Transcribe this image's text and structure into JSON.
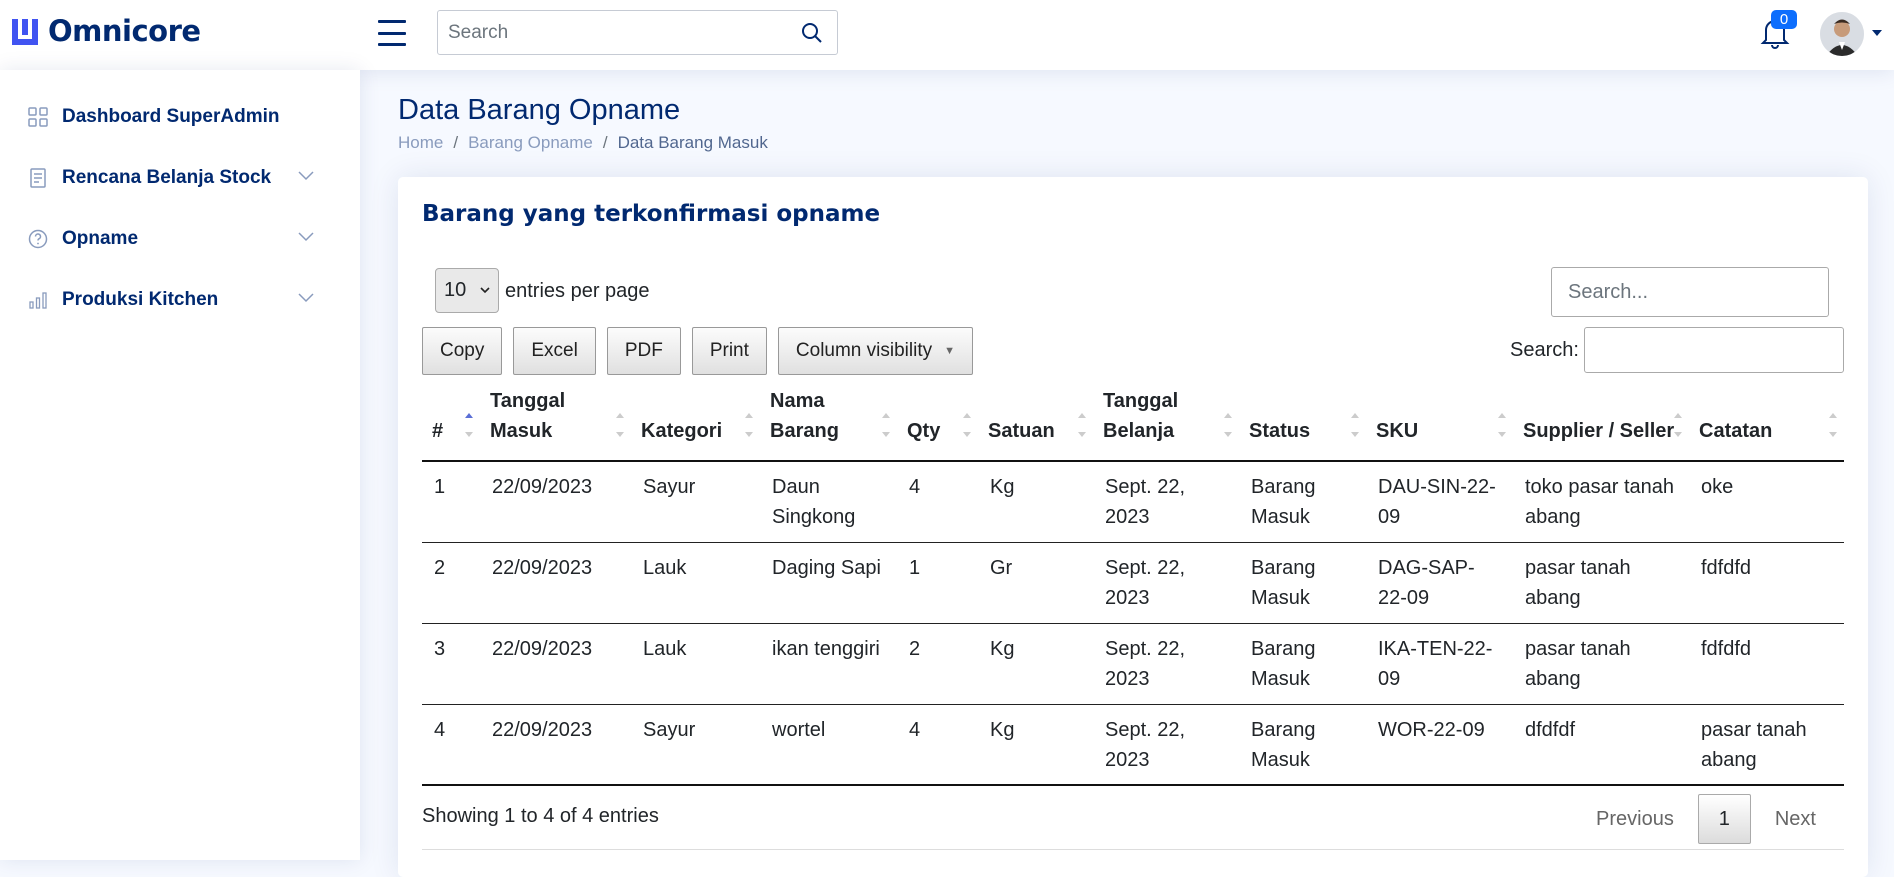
{
  "header": {
    "brand": "Omnicore",
    "search_placeholder": "Search",
    "notification_count": "0"
  },
  "sidebar": {
    "items": [
      {
        "label": "Dashboard SuperAdmin",
        "icon": "grid-icon",
        "has_submenu": false
      },
      {
        "label": "Rencana Belanja Stock",
        "icon": "journal-icon",
        "has_submenu": true
      },
      {
        "label": "Opname",
        "icon": "question-circle-icon",
        "has_submenu": true
      },
      {
        "label": "Produksi Kitchen",
        "icon": "bar-chart-icon",
        "has_submenu": true
      }
    ]
  },
  "page": {
    "title": "Data Barang Opname",
    "breadcrumb": [
      "Home",
      "Barang Opname",
      "Data Barang Masuk"
    ]
  },
  "card": {
    "title": "Barang yang terkonfirmasi opname",
    "entries_value": "10",
    "entries_label": "entries per page",
    "top_search_placeholder": "Search...",
    "buttons": [
      "Copy",
      "Excel",
      "PDF",
      "Print",
      "Column visibility"
    ],
    "search_label": "Search:",
    "columns": [
      "#",
      "Tanggal Masuk",
      "Kategori",
      "Nama Barang",
      "Qty",
      "Satuan",
      "Tanggal Belanja",
      "Status",
      "SKU",
      "Supplier / Seller",
      "Catatan"
    ],
    "rows": [
      [
        "1",
        "22/09/2023",
        "Sayur",
        "Daun Singkong",
        "4",
        "Kg",
        "Sept. 22, 2023",
        "Barang Masuk",
        "DAU-SIN-22-09",
        "toko pasar tanah abang",
        "oke"
      ],
      [
        "2",
        "22/09/2023",
        "Lauk",
        "Daging Sapi",
        "1",
        "Gr",
        "Sept. 22, 2023",
        "Barang Masuk",
        "DAG-SAP-22-09",
        "pasar tanah abang",
        "fdfdfd"
      ],
      [
        "3",
        "22/09/2023",
        "Lauk",
        "ikan tenggiri",
        "2",
        "Kg",
        "Sept. 22, 2023",
        "Barang Masuk",
        "IKA-TEN-22-09",
        "pasar tanah abang",
        "fdfdfd"
      ],
      [
        "4",
        "22/09/2023",
        "Sayur",
        "wortel",
        "4",
        "Kg",
        "Sept. 22, 2023",
        "Barang Masuk",
        "WOR-22-09",
        "dfdfdf",
        "pasar tanah abang"
      ]
    ],
    "info": "Showing 1 to 4 of 4 entries",
    "pager": {
      "prev": "Previous",
      "page": "1",
      "next": "Next"
    }
  },
  "colors": {
    "brand": "#012970",
    "accent": "#4154f1",
    "badge": "#0d6efd"
  }
}
